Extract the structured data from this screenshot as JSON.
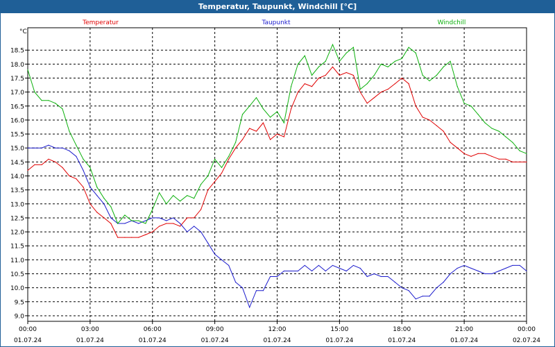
{
  "window": {
    "title": "Temperatur, Taupunkt, Windchill [°C]"
  },
  "chart_data": {
    "type": "line",
    "ylabel": "°C",
    "ylim": [
      8.8,
      19.3
    ],
    "yticks": [
      "9.0",
      "9.5",
      "10.0",
      "10.5",
      "11.0",
      "11.5",
      "12.0",
      "12.5",
      "13.0",
      "13.5",
      "14.0",
      "14.5",
      "15.0",
      "15.5",
      "16.0",
      "16.5",
      "17.0",
      "17.5",
      "18.0",
      "18.5"
    ],
    "xlim": [
      0,
      24
    ],
    "xticks": [
      {
        "time": "00:00",
        "date": "01.07.24"
      },
      {
        "time": "03:00",
        "date": "01.07.24"
      },
      {
        "time": "06:00",
        "date": "01.07.24"
      },
      {
        "time": "09:00",
        "date": "01.07.24"
      },
      {
        "time": "12:00",
        "date": "01.07.24"
      },
      {
        "time": "15:00",
        "date": "01.07.24"
      },
      {
        "time": "18:00",
        "date": "01.07.24"
      },
      {
        "time": "21:00",
        "date": "01.07.24"
      },
      {
        "time": "00:00",
        "date": "02.07.24"
      }
    ],
    "grid": true,
    "x_hours": [
      0,
      0.33,
      0.67,
      1,
      1.33,
      1.67,
      2,
      2.33,
      2.67,
      3,
      3.33,
      3.67,
      4,
      4.33,
      4.67,
      5,
      5.33,
      5.67,
      6,
      6.33,
      6.67,
      7,
      7.33,
      7.67,
      8,
      8.33,
      8.67,
      9,
      9.33,
      9.67,
      10,
      10.33,
      10.67,
      11,
      11.33,
      11.67,
      12,
      12.33,
      12.67,
      13,
      13.33,
      13.67,
      14,
      14.33,
      14.67,
      15,
      15.33,
      15.67,
      16,
      16.33,
      16.67,
      17,
      17.33,
      17.67,
      18,
      18.33,
      18.67,
      19,
      19.33,
      19.67,
      20,
      20.33,
      20.67,
      21,
      21.33,
      21.67,
      22,
      22.33,
      22.67,
      23,
      23.33,
      23.67,
      24
    ],
    "series": [
      {
        "name": "Temperatur",
        "color": "#e00000",
        "values": [
          14.2,
          14.4,
          14.4,
          14.6,
          14.5,
          14.3,
          14.0,
          13.9,
          13.6,
          13.0,
          12.7,
          12.5,
          12.3,
          11.8,
          11.8,
          11.8,
          11.8,
          11.9,
          12.0,
          12.2,
          12.3,
          12.3,
          12.2,
          12.5,
          12.5,
          12.8,
          13.5,
          13.8,
          14.1,
          14.6,
          15.0,
          15.3,
          15.7,
          15.6,
          15.9,
          15.3,
          15.5,
          15.4,
          16.4,
          17.0,
          17.3,
          17.2,
          17.5,
          17.6,
          17.9,
          17.6,
          17.7,
          17.6,
          17.0,
          16.6,
          16.8,
          17.0,
          17.1,
          17.3,
          17.5,
          17.3,
          16.5,
          16.1,
          16.0,
          15.8,
          15.6,
          15.2,
          15.0,
          14.8,
          14.7,
          14.8,
          14.8,
          14.7,
          14.6,
          14.6,
          14.5,
          14.5,
          14.5
        ]
      },
      {
        "name": "Taupunkt",
        "color": "#1a1acc",
        "values": [
          15.0,
          15.0,
          15.0,
          15.1,
          15.0,
          15.0,
          14.9,
          14.7,
          14.2,
          13.6,
          13.3,
          13.0,
          12.5,
          12.3,
          12.3,
          12.4,
          12.3,
          12.4,
          12.5,
          12.5,
          12.4,
          12.5,
          12.3,
          12.0,
          12.2,
          12.0,
          11.6,
          11.2,
          11.0,
          10.8,
          10.2,
          10.0,
          9.3,
          9.9,
          9.9,
          10.4,
          10.4,
          10.6,
          10.6,
          10.6,
          10.8,
          10.6,
          10.8,
          10.6,
          10.8,
          10.7,
          10.6,
          10.8,
          10.7,
          10.4,
          10.5,
          10.4,
          10.4,
          10.2,
          10.0,
          9.9,
          9.6,
          9.7,
          9.7,
          10.0,
          10.2,
          10.5,
          10.7,
          10.8,
          10.7,
          10.6,
          10.5,
          10.5,
          10.6,
          10.7,
          10.8,
          10.8,
          10.6
        ]
      },
      {
        "name": "Windchill",
        "color": "#0cb00c",
        "values": [
          17.8,
          17.0,
          16.7,
          16.7,
          16.6,
          16.4,
          15.6,
          15.1,
          14.6,
          14.3,
          13.6,
          13.2,
          12.9,
          12.3,
          12.6,
          12.4,
          12.4,
          12.3,
          12.8,
          13.4,
          13.0,
          13.3,
          13.1,
          13.3,
          13.2,
          13.7,
          14.0,
          14.6,
          14.3,
          14.7,
          15.2,
          16.2,
          16.5,
          16.8,
          16.4,
          16.1,
          16.3,
          15.9,
          17.2,
          18.0,
          18.3,
          17.6,
          17.9,
          18.1,
          18.7,
          18.1,
          18.4,
          18.6,
          17.1,
          17.3,
          17.6,
          18.0,
          17.9,
          18.1,
          18.2,
          18.6,
          18.4,
          17.6,
          17.4,
          17.6,
          17.9,
          18.1,
          17.2,
          16.6,
          16.5,
          16.2,
          15.9,
          15.7,
          15.6,
          15.4,
          15.2,
          14.9,
          14.8
        ]
      }
    ]
  }
}
